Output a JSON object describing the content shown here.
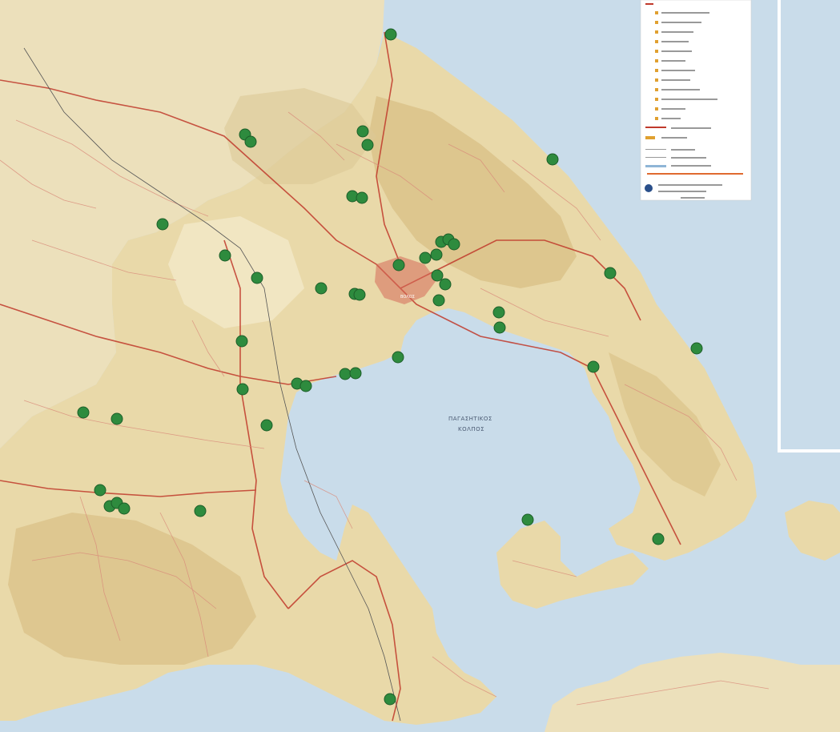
{
  "map": {
    "labels": {
      "gulf_line1": "ΠΑΓΑΣΗΤΙΚΟΣ",
      "gulf_line2": "ΚΟΛΠΟΣ",
      "city": "ΒΟΛΟΣ"
    },
    "colors": {
      "sea": "#c9dcea",
      "land": "#e9d9a9",
      "mountain": "#d7bf88",
      "road_major": "#c0392b",
      "road_minor": "#d98b7a",
      "marker": "#2e8b3e",
      "marker_stroke": "#1d5e29"
    },
    "legend": {
      "visible": true,
      "position": "top-right"
    },
    "markers": [
      {
        "id": "m01"
      },
      {
        "id": "m02"
      },
      {
        "id": "m03"
      },
      {
        "id": "m04"
      },
      {
        "id": "m05"
      },
      {
        "id": "m06"
      },
      {
        "id": "m07"
      },
      {
        "id": "m08"
      },
      {
        "id": "m09"
      },
      {
        "id": "m10"
      },
      {
        "id": "m11"
      },
      {
        "id": "m12"
      },
      {
        "id": "m13"
      },
      {
        "id": "m14"
      },
      {
        "id": "m15"
      },
      {
        "id": "m16"
      },
      {
        "id": "m17"
      },
      {
        "id": "m18"
      },
      {
        "id": "m19"
      },
      {
        "id": "m20"
      },
      {
        "id": "m21"
      },
      {
        "id": "m22"
      },
      {
        "id": "m23"
      },
      {
        "id": "m24"
      },
      {
        "id": "m25"
      },
      {
        "id": "m26"
      },
      {
        "id": "m27"
      },
      {
        "id": "m28"
      },
      {
        "id": "m29"
      },
      {
        "id": "m30"
      },
      {
        "id": "m31"
      },
      {
        "id": "m32"
      },
      {
        "id": "m33"
      },
      {
        "id": "m34"
      },
      {
        "id": "m35"
      },
      {
        "id": "m36"
      },
      {
        "id": "m37"
      },
      {
        "id": "m38"
      },
      {
        "id": "m39"
      },
      {
        "id": "m40"
      },
      {
        "id": "m41"
      },
      {
        "id": "m42"
      },
      {
        "id": "m43"
      },
      {
        "id": "m44"
      },
      {
        "id": "m45"
      },
      {
        "id": "m46"
      },
      {
        "id": "m47"
      },
      {
        "id": "m48"
      },
      {
        "id": "m49"
      },
      {
        "id": "m50"
      },
      {
        "id": "m51"
      },
      {
        "id": "m52"
      },
      {
        "id": "m53"
      },
      {
        "id": "m54"
      }
    ]
  }
}
